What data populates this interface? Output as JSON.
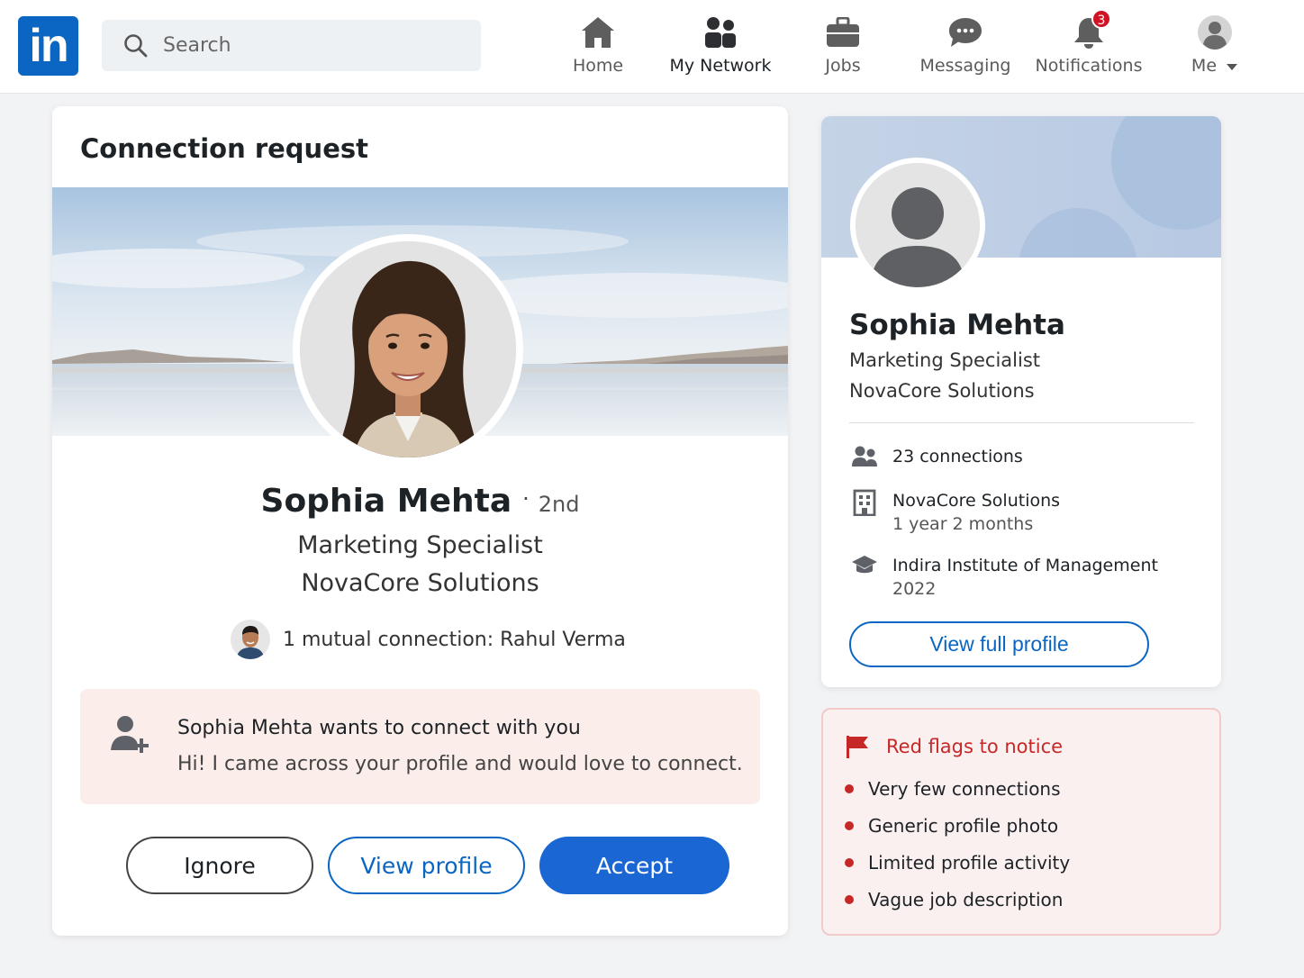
{
  "colors": {
    "brand": "#0a66c2",
    "accept": "#1a66d2",
    "red_flag": "#c62828",
    "notification_badge": "#d11124"
  },
  "header": {
    "logo_text": "in",
    "search": {
      "placeholder": "Search",
      "icon": "search-icon"
    },
    "nav": [
      {
        "label": "Home",
        "icon": "home-icon"
      },
      {
        "label": "My Network",
        "icon": "my-network-icon",
        "active": true
      },
      {
        "label": "Jobs",
        "icon": "briefcase-icon"
      },
      {
        "label": "Messaging",
        "icon": "messaging-icon"
      },
      {
        "label": "Notifications",
        "icon": "bell-icon",
        "badge": "3"
      },
      {
        "label": "Me",
        "icon": "avatar-icon",
        "dropdown": true
      }
    ]
  },
  "request_card": {
    "title": "Connection request",
    "name": "Sophia Mehta",
    "separator": "·",
    "degree": "2nd",
    "headline": "Marketing Specialist",
    "company": "NovaCore Solutions",
    "mutual_text": "1 mutual connection: Rahul Verma",
    "message": {
      "heading": "Sophia Mehta wants to connect with you",
      "body": "Hi! I came across your profile and would love to connect."
    },
    "buttons": {
      "ignore": "Ignore",
      "view_profile": "View profile",
      "accept": "Accept"
    }
  },
  "profile_card": {
    "name": "Sophia Mehta",
    "headline": "Marketing Specialist",
    "company": "NovaCore Solutions",
    "connections": "23 connections",
    "experience": {
      "company": "NovaCore Solutions",
      "duration": "1 year 2 months"
    },
    "education": {
      "school": "Indira Institute of Management",
      "year": "2022"
    },
    "button": "View full profile"
  },
  "red_flags": {
    "title": "Red flags to notice",
    "items": [
      "Very few connections",
      "Generic profile photo",
      "Limited profile activity",
      "Vague job description"
    ]
  }
}
